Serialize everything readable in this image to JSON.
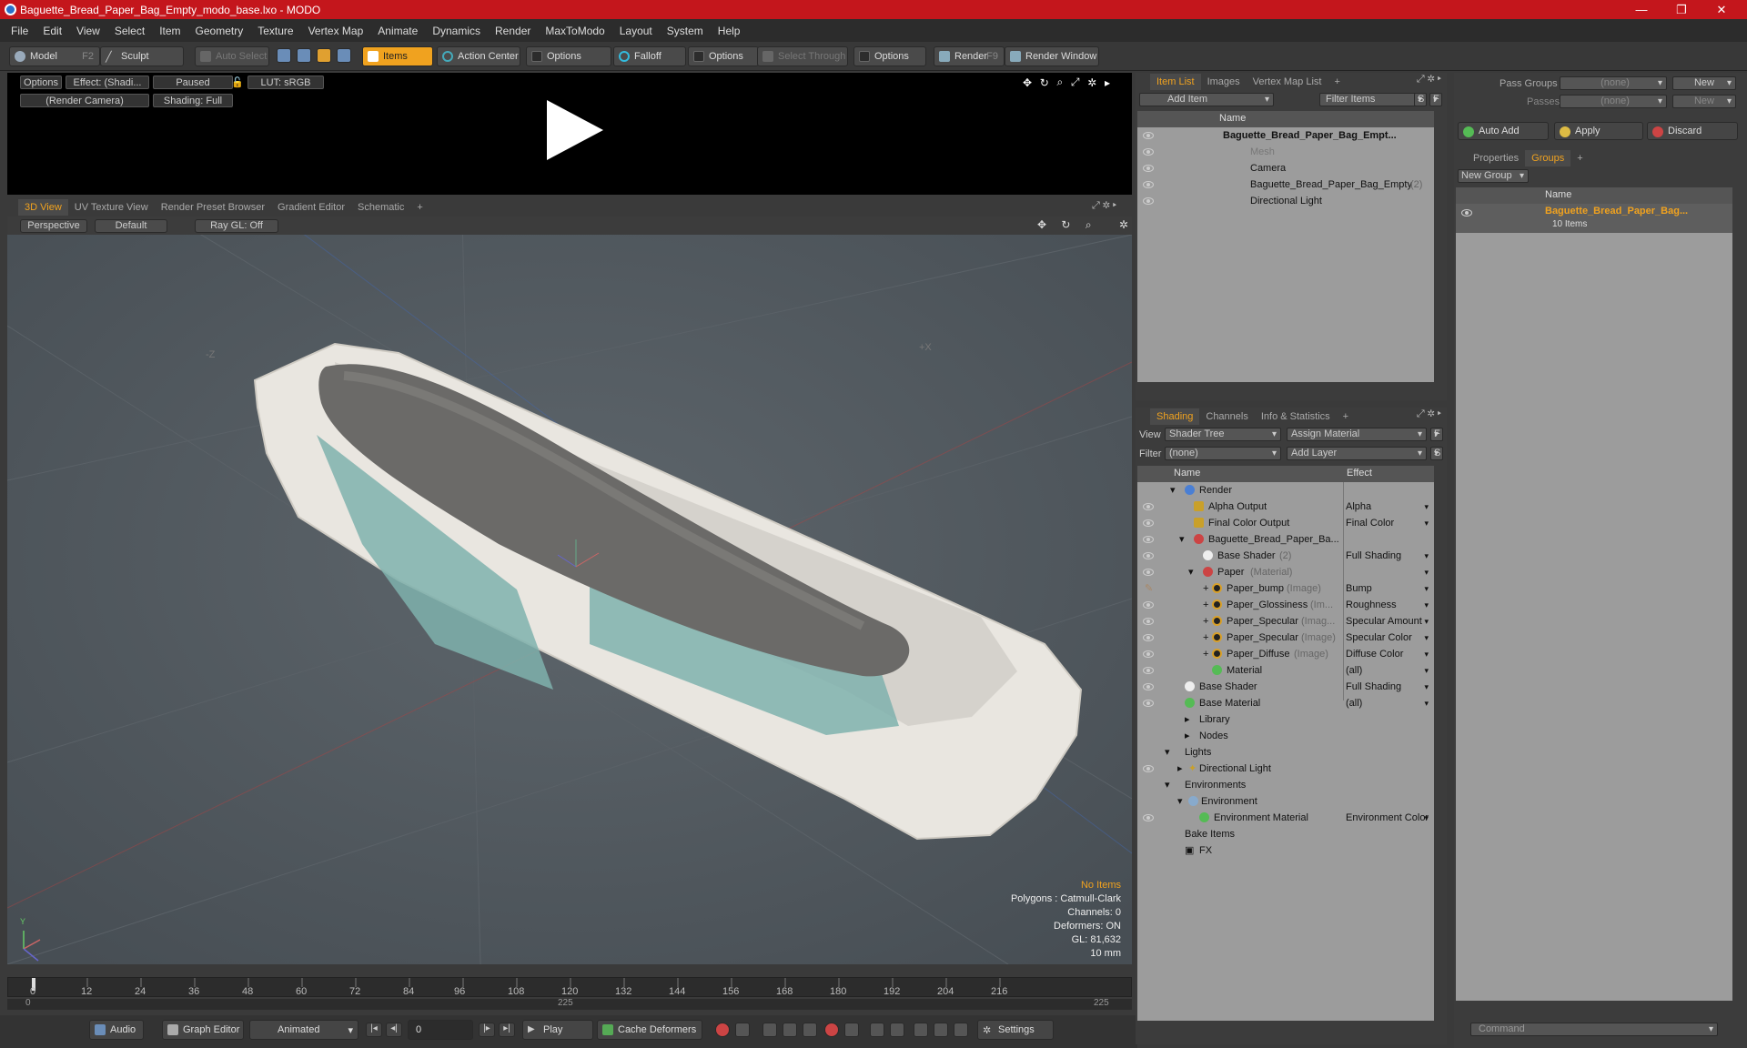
{
  "window": {
    "title": "Baguette_Bread_Paper_Bag_Empty_modo_base.lxo - MODO",
    "min": "—",
    "max": "❐",
    "close": "✕"
  },
  "menu": [
    "File",
    "Edit",
    "View",
    "Select",
    "Item",
    "Geometry",
    "Texture",
    "Vertex Map",
    "Animate",
    "Dynamics",
    "Render",
    "MaxToModo",
    "Layout",
    "System",
    "Help"
  ],
  "toolbar": {
    "model": "Model",
    "model_key": "F2",
    "sculpt": "Sculpt",
    "auto_select": "Auto Select",
    "items": "Items",
    "action_center": "Action Center",
    "options1": "Options",
    "falloff": "Falloff",
    "options2": "Options",
    "select_through": "Select Through",
    "options3": "Options",
    "render": "Render",
    "render_key": "F9",
    "render_window": "Render Window"
  },
  "preview": {
    "options": "Options",
    "effect": "Effect: (Shadi...",
    "paused": "Paused",
    "lut": "LUT: sRGB",
    "camera": "(Render Camera)",
    "shading": "Shading: Full"
  },
  "viewtabs": [
    "3D View",
    "UV Texture View",
    "Render Preset Browser",
    "Gradient Editor",
    "Schematic",
    "+"
  ],
  "viewport": {
    "perspective": "Perspective",
    "default": "Default",
    "raygl": "Ray GL: Off",
    "axis_z": "-Z",
    "axis_x": "+X",
    "axis_y": "Y"
  },
  "stats": {
    "no_items": "No Items",
    "polygons": "Polygons : Catmull-Clark",
    "channels": "Channels: 0",
    "deformers": "Deformers: ON",
    "gl": "GL: 81,632",
    "unit": "10 mm"
  },
  "timeline": {
    "ticks": [
      "0",
      "12",
      "24",
      "36",
      "48",
      "60",
      "72",
      "84",
      "96",
      "108",
      "120",
      "132",
      "144",
      "156",
      "168",
      "180",
      "192",
      "204",
      "216"
    ],
    "start": "0",
    "mid": "225",
    "end": "225"
  },
  "bottombar": {
    "audio": "Audio",
    "graph_editor": "Graph Editor",
    "animated": "Animated",
    "frame": "0",
    "play": "Play",
    "cache": "Cache Deformers",
    "settings": "Settings"
  },
  "itemlist": {
    "tabs": [
      "Item List",
      "Images",
      "Vertex Map List",
      "+"
    ],
    "add_item": "Add Item",
    "filter": "Filter Items",
    "s": "S",
    "f": "F",
    "col_name": "Name",
    "rows": [
      {
        "label": "Baguette_Bread_Paper_Bag_Empt...",
        "bold": true
      },
      {
        "label": "Mesh",
        "dim": true
      },
      {
        "label": "Camera"
      },
      {
        "label": "Baguette_Bread_Paper_Bag_Empty",
        "suffix": "(2)"
      },
      {
        "label": "Directional Light"
      }
    ]
  },
  "shading": {
    "tabs": [
      "Shading",
      "Channels",
      "Info & Statistics",
      "+"
    ],
    "view_label": "View",
    "view_value": "Shader Tree",
    "assign": "Assign Material",
    "filter_label": "Filter",
    "filter_value": "(none)",
    "add_layer": "Add Layer",
    "f": "F",
    "s": "S",
    "col_name": "Name",
    "col_effect": "Effect",
    "rows": [
      {
        "label": "Render",
        "effect": "",
        "indent": 0
      },
      {
        "label": "Alpha Output",
        "effect": "Alpha",
        "indent": 1
      },
      {
        "label": "Final Color Output",
        "effect": "Final Color",
        "indent": 1
      },
      {
        "label": "Baguette_Bread_Paper_Ba...",
        "effect": "",
        "indent": 1
      },
      {
        "label": "Base Shader",
        "suffix": "(2)",
        "effect": "Full Shading",
        "indent": 2
      },
      {
        "label": "Paper",
        "suffix": "(Material)",
        "effect": "",
        "indent": 2
      },
      {
        "label": "Paper_bump",
        "suffix": "(Image)",
        "effect": "Bump",
        "indent": 3
      },
      {
        "label": "Paper_Glossiness",
        "suffix": "(Im...",
        "effect": "Roughness",
        "indent": 3
      },
      {
        "label": "Paper_Specular",
        "suffix": "(Imag...",
        "effect": "Specular Amount",
        "indent": 3
      },
      {
        "label": "Paper_Specular",
        "suffix": "(Image)",
        "effect": "Specular Color",
        "indent": 3
      },
      {
        "label": "Paper_Diffuse",
        "suffix": "(Image)",
        "effect": "Diffuse Color",
        "indent": 3
      },
      {
        "label": "Material",
        "effect": "(all)",
        "indent": 3
      },
      {
        "label": "Base Shader",
        "effect": "Full Shading",
        "indent": 1
      },
      {
        "label": "Base Material",
        "effect": "(all)",
        "indent": 1
      },
      {
        "label": "Library",
        "effect": "",
        "indent": 1
      },
      {
        "label": "Nodes",
        "effect": "",
        "indent": 1
      },
      {
        "label": "Lights",
        "effect": "",
        "indent": 0
      },
      {
        "label": "Directional Light",
        "effect": "",
        "indent": 1
      },
      {
        "label": "Environments",
        "effect": "",
        "indent": 0
      },
      {
        "label": "Environment",
        "effect": "",
        "indent": 1
      },
      {
        "label": "Environment Material",
        "effect": "Environment Color",
        "indent": 2
      },
      {
        "label": "Bake Items",
        "effect": "",
        "indent": 0
      },
      {
        "label": "FX",
        "effect": "",
        "indent": 1
      }
    ]
  },
  "groups": {
    "pass_groups": "Pass Groups",
    "passes": "Passes",
    "none1": "(none)",
    "none2": "(none)",
    "new1": "New",
    "new2": "New",
    "auto_add": "Auto Add",
    "apply": "Apply",
    "discard": "Discard",
    "tabs": [
      "Properties",
      "Groups",
      "+"
    ],
    "new_group": "New Group",
    "col_name": "Name",
    "group_name": "Baguette_Bread_Paper_Bag...",
    "group_count": "10 Items",
    "command": "Command"
  }
}
